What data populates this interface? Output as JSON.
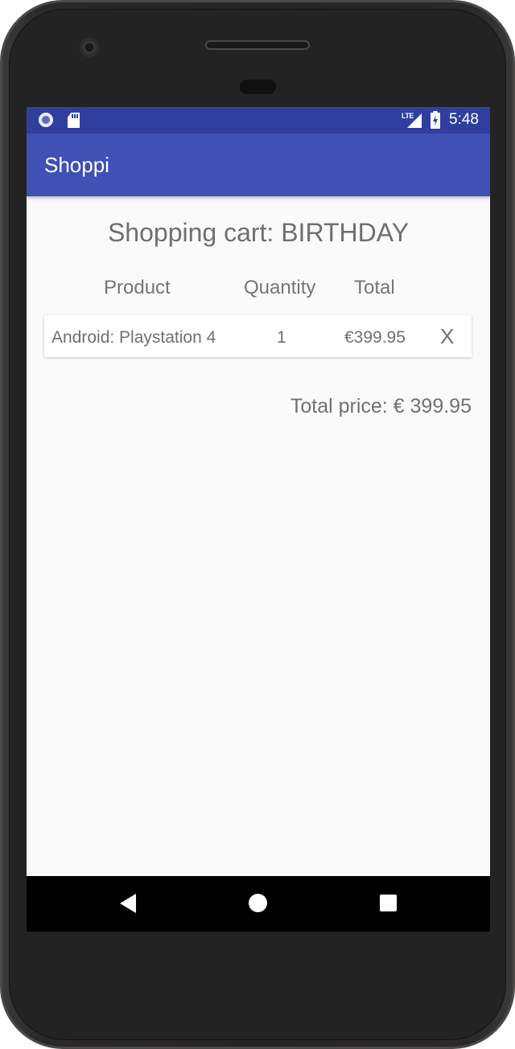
{
  "status_bar": {
    "network_label": "LTE",
    "time": "5:48",
    "icons": [
      "assistant-icon",
      "sd-card-icon",
      "signal-icon",
      "battery-charging-icon"
    ]
  },
  "app_bar": {
    "title": "Shoppi"
  },
  "cart": {
    "title": "Shopping cart: BIRTHDAY",
    "columns": {
      "product": "Product",
      "quantity": "Quantity",
      "total": "Total"
    },
    "items": [
      {
        "product": "Android: Playstation 4",
        "quantity": "1",
        "total": "€399.95",
        "remove_label": "X"
      }
    ],
    "total_price": "Total price: € 399.95"
  },
  "nav_bar": {
    "buttons": [
      "back",
      "home",
      "recents"
    ]
  },
  "colors": {
    "status_bar": "#303f9f",
    "app_bar": "#3f51b5",
    "background": "#fafafa",
    "text": "#707070"
  }
}
